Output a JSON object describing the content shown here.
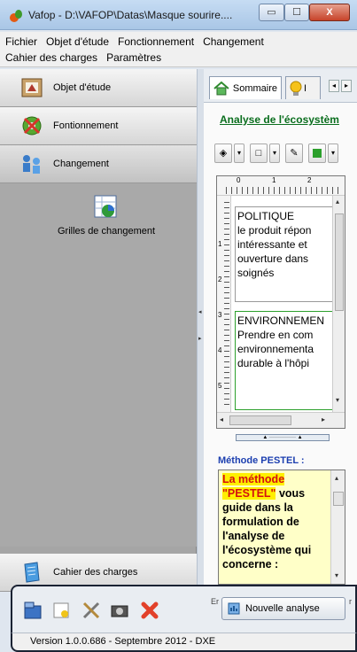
{
  "window": {
    "title": "Vafop - D:\\VAFOP\\Datas\\Masque sourire....",
    "controls": {
      "minimize": "▭",
      "maximize": "☐",
      "close": "X"
    }
  },
  "menu": {
    "row1": [
      "Fichier",
      "Objet d'étude",
      "Fonctionnement",
      "Changement"
    ],
    "row2": [
      "Cahier des charges",
      "Paramètres"
    ]
  },
  "nav": {
    "objet": "Objet d'étude",
    "fonctionnement": "Fontionnement",
    "changement": "Changement",
    "grille": "Grilles de changement",
    "cahier": "Cahier des charges"
  },
  "tabs": {
    "sommaire": "Sommaire",
    "second": "I"
  },
  "section_title": "Analyse de l'écosystèm",
  "ruler": {
    "h": [
      "0",
      "1",
      "2"
    ],
    "v": [
      "1",
      "2",
      "3",
      "4",
      "5"
    ]
  },
  "editor": {
    "box1": [
      "POLITIQUE",
      "le produit répon",
      "intéressante et",
      "ouverture dans",
      "soignés"
    ],
    "box2": [
      "ENVIRONNEMEN",
      "Prendre en com",
      "environnementa",
      "durable à l'hôpi"
    ]
  },
  "pestel": {
    "title": "Méthode PESTEL :",
    "hl1": "La méthode",
    "hl2": "\"PESTEL\"",
    "text_after": " vous guide dans la formulation de l'analyse de l'écosystème qui concerne :"
  },
  "bottom": {
    "sep1": "Er",
    "nouvelle": "Nouvelle analyse",
    "sep2": "r"
  },
  "status": "Version 1.0.0.686 - Septembre 2012 - DXE",
  "colors": {
    "section_green": "#0a6e1e",
    "pestel_blue": "#1c3fb0",
    "pestel_bg": "#ffffc8",
    "highlight_yellow": "#ffef00",
    "highlight_red": "#d41010"
  }
}
